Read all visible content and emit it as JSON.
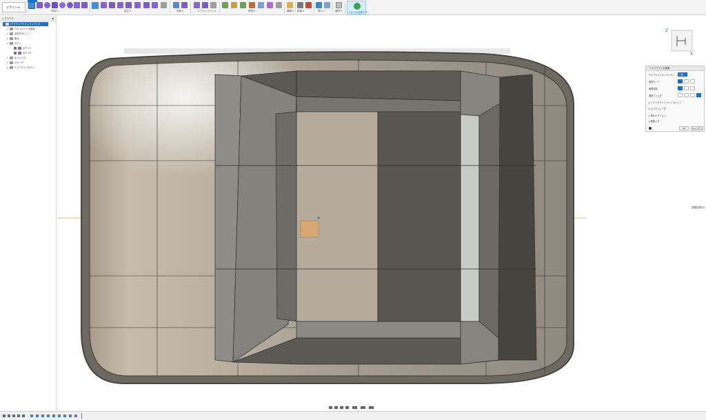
{
  "toolbar": {
    "workspace_label": "デザイン ▾",
    "groups": [
      {
        "label": "作成 ▾"
      },
      {
        "label": "修正 ▾"
      },
      {
        "label": "対称 ▾"
      },
      {
        "label": "ユーティリティ ▾"
      },
      {
        "label": "修復 ▾"
      },
      {
        "label": "構築 ▾"
      },
      {
        "label": "検査 ▾"
      },
      {
        "label": "挿入 ▾"
      },
      {
        "label": "選択 ▾"
      }
    ],
    "finish_label": "フォームを終了 ▾"
  },
  "browser": {
    "title": "ブラウザ",
    "items": [
      {
        "label": "(アクティブドキュメント) v1"
      },
      {
        "label": "ドキュメントの設定"
      },
      {
        "label": "名前付きビュー"
      },
      {
        "label": "原点"
      },
      {
        "label": "ボディ"
      },
      {
        "label": "ボディ1"
      },
      {
        "label": "ボディ2"
      },
      {
        "label": "キャンバス"
      },
      {
        "label": "スケッチ"
      },
      {
        "label": "T-スプラインボディ"
      }
    ]
  },
  "viewcube": {
    "z_label": "Z",
    "x_label": "X"
  },
  "panel": {
    "title": "T-スプラインを編集",
    "rows": [
      {
        "label": "T-スプラインエンティティ"
      },
      {
        "label": "選択モード"
      },
      {
        "label": "座標空間"
      },
      {
        "label": "選択フィルタ"
      },
      {
        "label": "ソフトモディファイ / スナップ"
      },
      {
        "label": "マニピュレータ"
      },
      {
        "label": "表示オプション"
      },
      {
        "label": "数値入力"
      }
    ],
    "selected_value": "1 面",
    "ok_label": "OK",
    "cancel_label": "キャンセル"
  },
  "side_hint": "[関連を表示]",
  "colors": {
    "accent": "#1e6fc2",
    "selected_face": "#d8a874",
    "body_light": "#beb3a2",
    "body_dark": "#5c5a55",
    "finish_green": "#35a84a"
  },
  "bottom_icons": [
    "orbit-icon",
    "pan-icon",
    "zoom-icon",
    "fit-icon",
    "display-settings-icon",
    "grid-icon",
    "viewports-icon"
  ],
  "timeline_icons": [
    "first-icon",
    "prev-icon",
    "play-icon",
    "next-icon",
    "last-icon"
  ]
}
